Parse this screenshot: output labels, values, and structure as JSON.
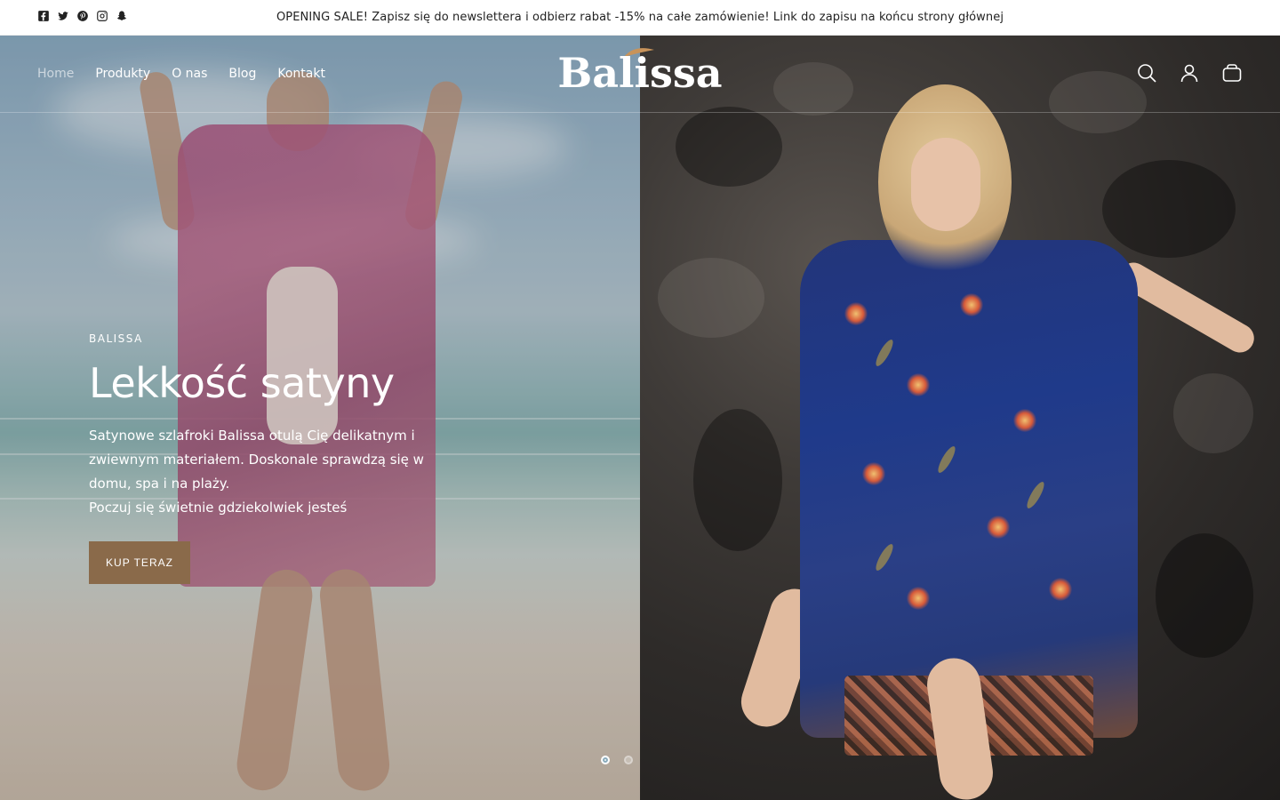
{
  "announcement": {
    "text": "OPENING SALE! Zapisz się do newslettera i odbierz rabat -15% na całe zamówienie! Link do zapisu na końcu strony głównej"
  },
  "socials": [
    "facebook-icon",
    "twitter-icon",
    "pinterest-icon",
    "instagram-icon",
    "snapchat-icon"
  ],
  "nav": {
    "items": [
      {
        "label": "Home",
        "active": true
      },
      {
        "label": "Produkty"
      },
      {
        "label": "O nas"
      },
      {
        "label": "Blog"
      },
      {
        "label": "Kontakt"
      }
    ]
  },
  "logo": {
    "text": "Balissa"
  },
  "header_icons": [
    "search-icon",
    "account-icon",
    "cart-icon"
  ],
  "hero": {
    "eyebrow": "BALISSA",
    "title": "Lekkość satyny",
    "body": [
      "Satynowe szlafroki Balissa otulą Cię delikatnym i zwiewnym materiałem. Doskonale sprawdzą się w domu, spa i na plaży.",
      "Poczuj się świetnie gdziekolwiek jesteś"
    ],
    "cta_label": "KUP TERAZ",
    "cta_color": "#8a6a4a",
    "slides": 2,
    "active_slide": 1
  }
}
